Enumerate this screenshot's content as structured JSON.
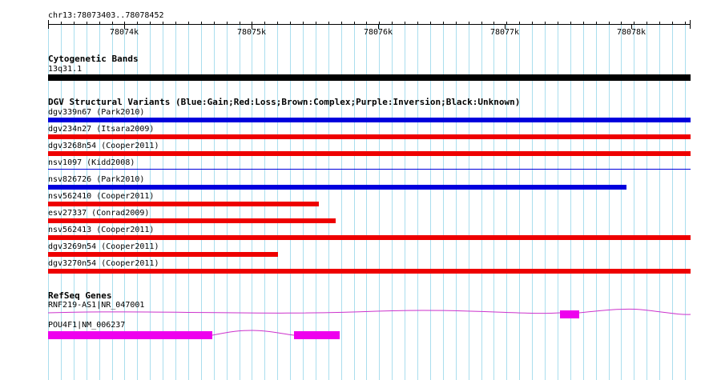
{
  "locus": "chr13:78073403..78078452",
  "ruler_ticks": [
    "78074k",
    "78075k",
    "78076k",
    "78077k",
    "78078k"
  ],
  "colors": {
    "grid": "#aadeee",
    "cytoband_black": "#000000",
    "gain_blue": "#0000dd",
    "loss_red": "#ee0000",
    "gene_magenta": "#ee00ee",
    "intron_line": "#cc33cc"
  },
  "tracks": {
    "cytoband": {
      "title": "Cytogenetic Bands",
      "band": "13q31.1"
    },
    "dgv": {
      "title": "DGV Structural Variants (Blue:Gain;Red:Loss;Brown:Complex;Purple:Inversion;Black:Unknown)",
      "variants": [
        {
          "label": "dgv339n67 (Park2010)",
          "type": "gain",
          "extent": "full"
        },
        {
          "label": "dgv234n27 (Itsara2009)",
          "type": "loss",
          "extent": "full"
        },
        {
          "label": "dgv3268n54 (Cooper2011)",
          "type": "loss",
          "extent": "full"
        },
        {
          "label": "nsv1097 (Kidd2008)",
          "type": "gain",
          "extent": "full",
          "thin": true
        },
        {
          "label": "nsv826726 (Park2010)",
          "type": "gain",
          "extent": "partial"
        },
        {
          "label": "nsv562410 (Cooper2011)",
          "type": "loss",
          "extent": "partial"
        },
        {
          "label": "esv27337 (Conrad2009)",
          "type": "loss",
          "extent": "partial"
        },
        {
          "label": "nsv562413 (Cooper2011)",
          "type": "loss",
          "extent": "full"
        },
        {
          "label": "dgv3269n54 (Cooper2011)",
          "type": "loss",
          "extent": "partial"
        },
        {
          "label": "dgv3270n54 (Cooper2011)",
          "type": "loss",
          "extent": "full"
        }
      ]
    },
    "refseq": {
      "title": "RefSeq Genes",
      "genes": [
        {
          "label": "RNF219-AS1|NR_047001"
        },
        {
          "label": "POU4F1|NM_006237"
        }
      ]
    }
  }
}
